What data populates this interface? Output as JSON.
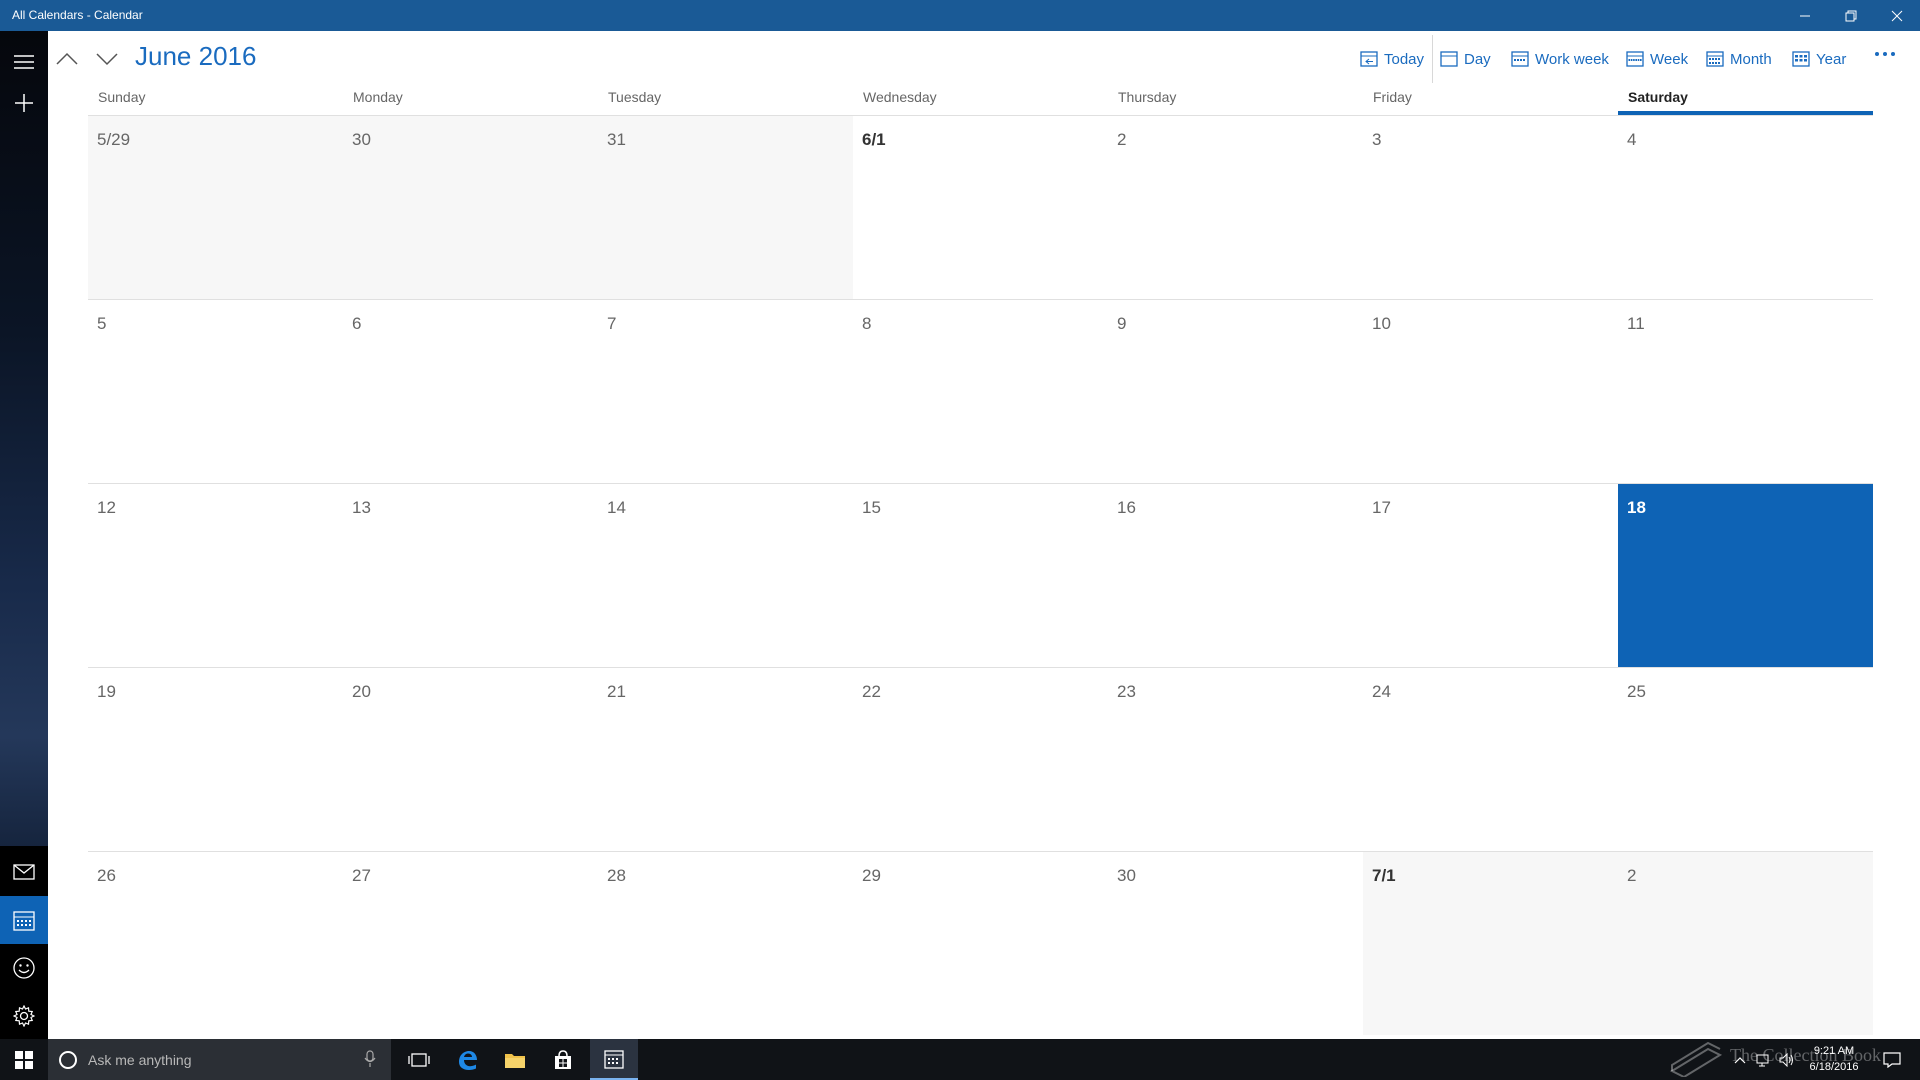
{
  "window": {
    "title": "All Calendars - Calendar"
  },
  "header": {
    "month_label": "June 2016",
    "views": {
      "today": "Today",
      "day": "Day",
      "work_week": "Work week",
      "week": "Week",
      "month": "Month",
      "year": "Year"
    }
  },
  "weekdays": [
    "Sunday",
    "Monday",
    "Tuesday",
    "Wednesday",
    "Thursday",
    "Friday",
    "Saturday"
  ],
  "selected_weekday": "Saturday",
  "weeks": [
    [
      "5/29",
      "30",
      "31",
      "6/1",
      "2",
      "3",
      "4"
    ],
    [
      "5",
      "6",
      "7",
      "8",
      "9",
      "10",
      "11"
    ],
    [
      "12",
      "13",
      "14",
      "15",
      "16",
      "17",
      "18"
    ],
    [
      "19",
      "20",
      "21",
      "22",
      "23",
      "24",
      "25"
    ],
    [
      "26",
      "27",
      "28",
      "29",
      "30",
      "7/1",
      "2"
    ]
  ],
  "today_label": "18",
  "taskbar": {
    "search_placeholder": "Ask me anything",
    "time": "9:21 AM",
    "date": "6/18/2016",
    "watermark": "The Collection Book"
  },
  "colors": {
    "accent": "#0e63b5",
    "titlebar": "#1a5a96",
    "accent_text": "#1a6bbf"
  }
}
